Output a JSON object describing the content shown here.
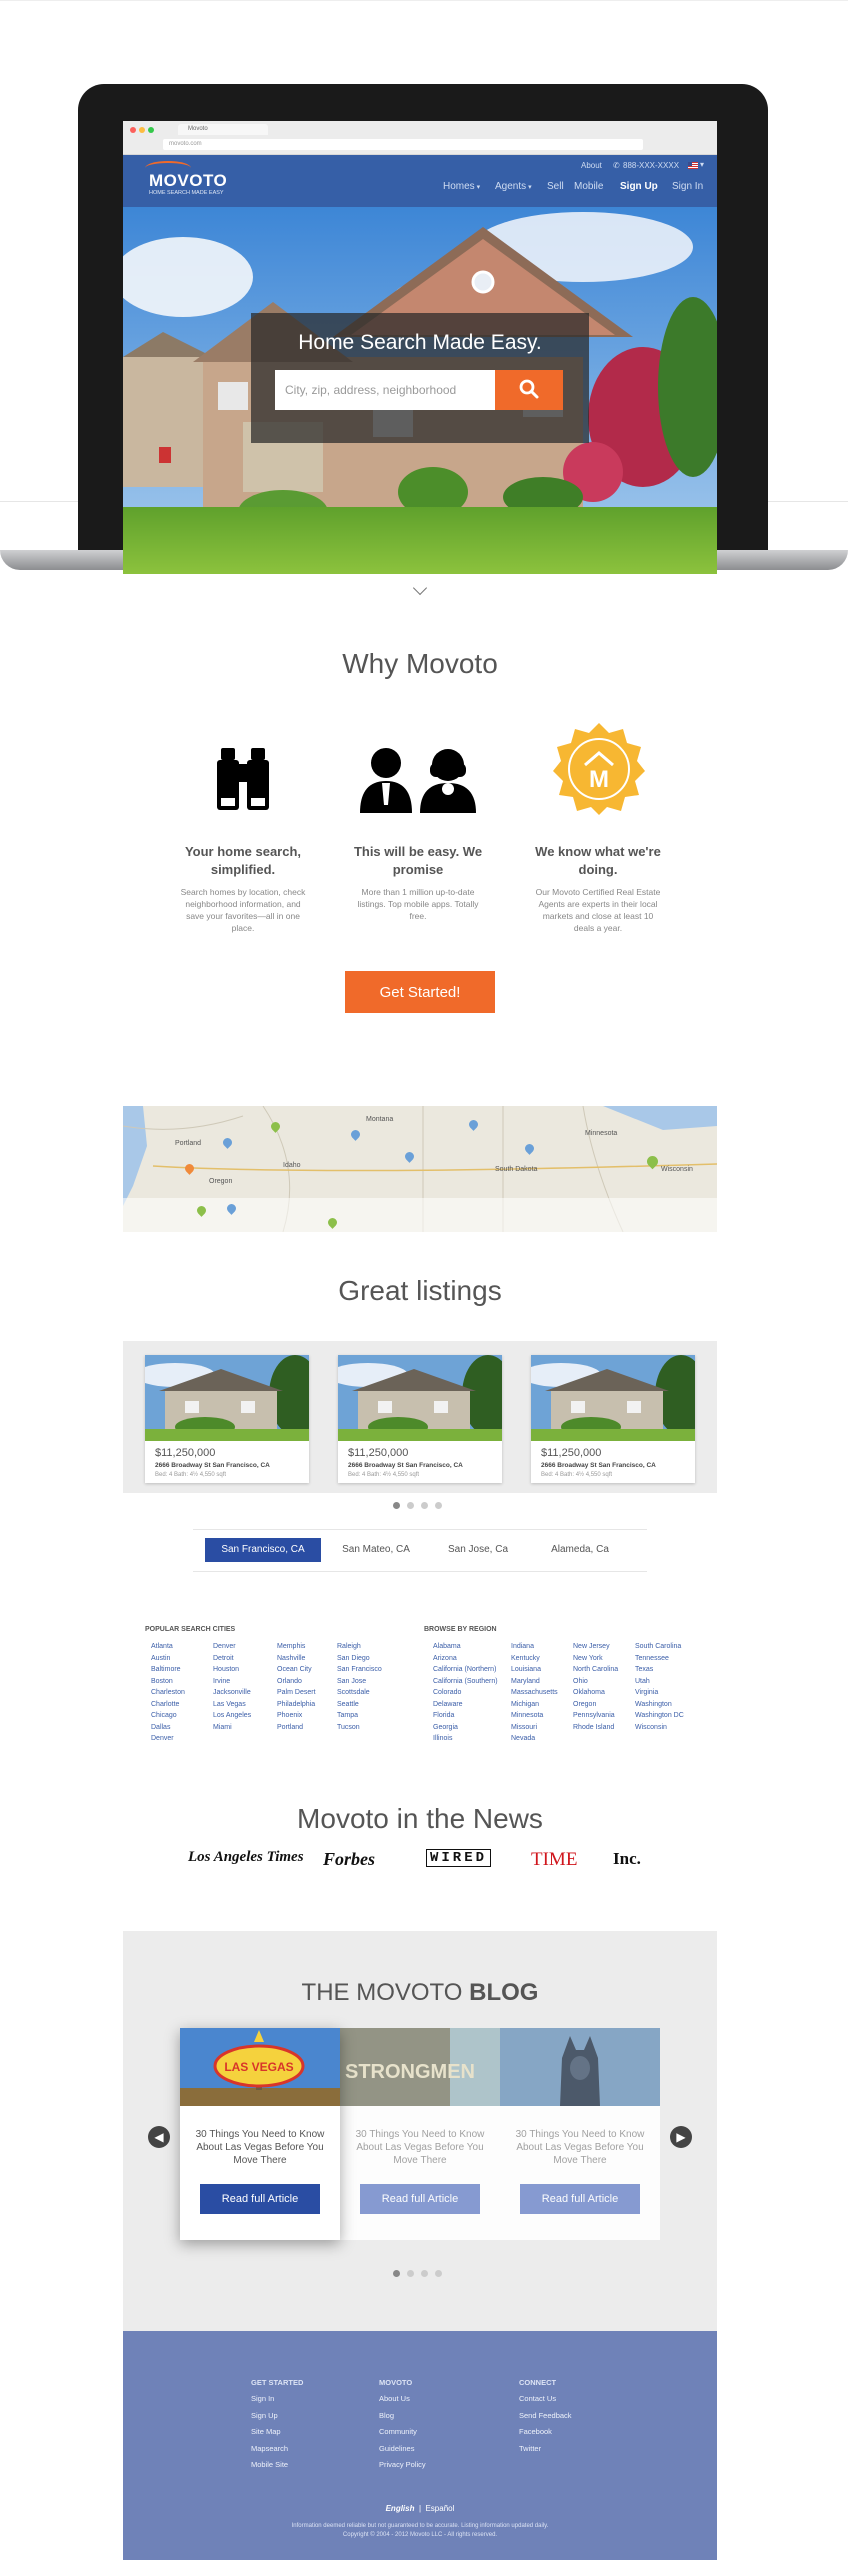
{
  "browser": {
    "tab_title": "Movoto",
    "url": "movoto.com"
  },
  "nav": {
    "logo": "MOVOTO",
    "tagline": "HOME SEARCH MADE EASY",
    "about": "About",
    "phone": "888-XXX-XXXX",
    "items": [
      "Homes",
      "Agents",
      "Sell",
      "Mobile",
      "Sign Up",
      "Sign In"
    ]
  },
  "hero": {
    "title": "Home Search Made Easy.",
    "search_placeholder": "City, zip, address, neighborhood"
  },
  "why": {
    "title": "Why Movoto",
    "features": [
      {
        "title": "Your home search, simplified.",
        "text": "Search homes by location, check neighborhood information, and save your favorites—all in one place."
      },
      {
        "title": "This will be easy. We promise",
        "text": "More than 1 million up-to-date listings. Top mobile apps. Totally free."
      },
      {
        "title": "We know what we're doing.",
        "text": "Our Movoto Certified Real Estate Agents are experts in their local markets and close at least 10 deals a year."
      }
    ],
    "cta": "Get Started!"
  },
  "map": {
    "labels": [
      "Portland",
      "Montana",
      "Minnesota",
      "Oregon",
      "Idaho",
      "South Dakota",
      "Wisconsin"
    ]
  },
  "listings": {
    "title": "Great listings",
    "cards": [
      {
        "price": "$11,250,000",
        "address": "2666 Broadway St San Francisco, CA",
        "meta": "Bed: 4    Bath: 4½    4,550 sqft"
      },
      {
        "price": "$11,250,000",
        "address": "2666 Broadway St San Francisco, CA",
        "meta": "Bed: 4    Bath: 4½    4,550 sqft"
      },
      {
        "price": "$11,250,000",
        "address": "2666 Broadway St San Francisco, CA",
        "meta": "Bed: 4    Bath: 4½    4,550 sqft"
      }
    ],
    "cities": [
      "San Francisco, CA",
      "San Mateo, CA",
      "San Jose, Ca",
      "Alameda, Ca"
    ]
  },
  "popular": {
    "heading": "POPULAR SEARCH CITIES",
    "col1": [
      "Atlanta",
      "Austin",
      "Baltimore",
      "Boston",
      "Charleston",
      "Charlotte",
      "Chicago",
      "Dallas",
      "Denver"
    ],
    "col2": [
      "Denver",
      "Detroit",
      "Houston",
      "Irvine",
      "Jacksonville",
      "Las Vegas",
      "Los Angeles",
      "Miami"
    ],
    "col3": [
      "Memphis",
      "Nashville",
      "Ocean City",
      "Orlando",
      "Palm Desert",
      "Philadelphia",
      "Phoenix",
      "Portland"
    ],
    "col4": [
      "Raleigh",
      "San Diego",
      "San Francisco",
      "San Jose",
      "Scottsdale",
      "Seattle",
      "Tampa",
      "Tucson"
    ]
  },
  "region": {
    "heading": "BROWSE BY REGION",
    "col1": [
      "Alabama",
      "Arizona",
      "California (Northern)",
      "California (Southern)",
      "Colorado",
      "Delaware",
      "Florida",
      "Georgia",
      "Illinois"
    ],
    "col2": [
      "Indiana",
      "Kentucky",
      "Louisiana",
      "Maryland",
      "Massachusetts",
      "Michigan",
      "Minnesota",
      "Missouri",
      "Nevada"
    ],
    "col3": [
      "New Jersey",
      "New York",
      "North Carolina",
      "Ohio",
      "Oklahoma",
      "Oregon",
      "Pennsylvania",
      "Rhode Island"
    ],
    "col4": [
      "South Carolina",
      "Tennessee",
      "Texas",
      "Utah",
      "Virginia",
      "Washington",
      "Washington DC",
      "Wisconsin"
    ]
  },
  "news": {
    "title": "Movoto in the News",
    "logos": [
      "Los Angeles Times",
      "Forbes",
      "WIRED",
      "TIME",
      "Inc."
    ]
  },
  "blog": {
    "title_light": "THE MOVOTO ",
    "title_bold": "BLOG",
    "cards": [
      {
        "text": "30 Things You Need to Know About Las Vegas Before You Move There",
        "button": "Read full Article",
        "img_text": "LAS VEGAS"
      },
      {
        "text": "30 Things You Need to Know About Las Vegas Before You Move There",
        "button": "Read full Article",
        "img_text": "STRONGMEN"
      },
      {
        "text": "30 Things You Need to Know About Las Vegas Before You Move There",
        "button": "Read full Article",
        "img_text": ""
      }
    ]
  },
  "footer": {
    "col1": {
      "heading": "GET STARTED",
      "links": [
        "Sign In",
        "Sign Up",
        "Site Map",
        "Mapsearch",
        "Mobile Site"
      ]
    },
    "col2": {
      "heading": "MOVOTO",
      "links": [
        "About Us",
        "Blog",
        "Community",
        "Guidelines",
        "Privacy Policy"
      ]
    },
    "col3": {
      "heading": "CONNECT",
      "links": [
        "Contact Us",
        "Send Feedback",
        "Facebook",
        "Twitter"
      ]
    },
    "lang_en": "English",
    "lang_sep": "|",
    "lang_es": "Español",
    "legal1": "Information deemed reliable but not guaranteed to be accurate. Listing information updated daily.",
    "legal2": "Copyright © 2004 - 2012 Movoto LLC - All rights reserved."
  },
  "colors": {
    "brand_blue": "#365fa7",
    "accent_orange": "#f06a2a",
    "footer_blue": "#6f82b8"
  }
}
